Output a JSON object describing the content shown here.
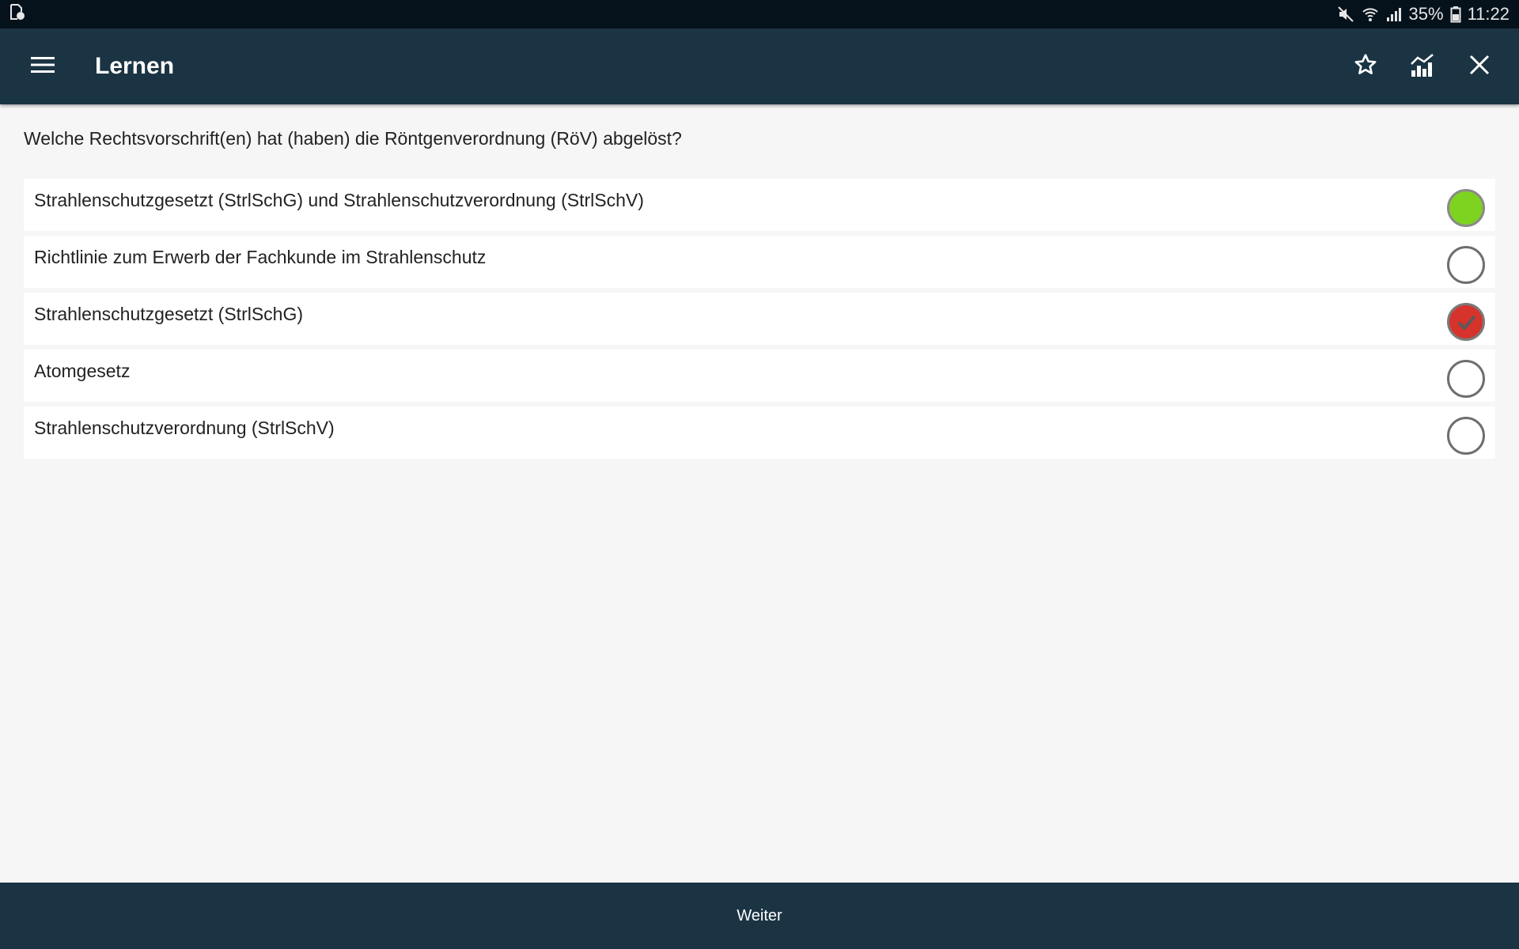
{
  "statusbar": {
    "battery": "35%",
    "time": "11:22"
  },
  "appbar": {
    "title": "Lernen"
  },
  "question": "Welche Rechtsvorschrift(en) hat (haben) die Röntgenverordnung (RöV) abgelöst?",
  "options": [
    {
      "text": "Strahlenschutzgesetzt (StrlSchG) und Strahlenschutzverordnung (StrlSchV)",
      "state": "correct"
    },
    {
      "text": "Richtlinie zum Erwerb der Fachkunde im Strahlenschutz",
      "state": "unselected"
    },
    {
      "text": "Strahlenschutzgesetzt (StrlSchG)",
      "state": "selected-wrong"
    },
    {
      "text": "Atomgesetz",
      "state": "unselected"
    },
    {
      "text": "Strahlenschutzverordnung (StrlSchV)",
      "state": "unselected"
    }
  ],
  "bottombar": {
    "next_label": "Weiter"
  },
  "colors": {
    "appbar": "#1b3443",
    "correct": "#7ed321",
    "wrong": "#d5332c",
    "background": "#f6f6f6"
  },
  "icons": {
    "statusbar": [
      "notification-icon",
      "mute-icon",
      "wifi-icon",
      "signal-icon",
      "battery-icon"
    ],
    "appbar": [
      "menu-icon",
      "star-icon",
      "statistics-icon",
      "close-icon"
    ]
  }
}
